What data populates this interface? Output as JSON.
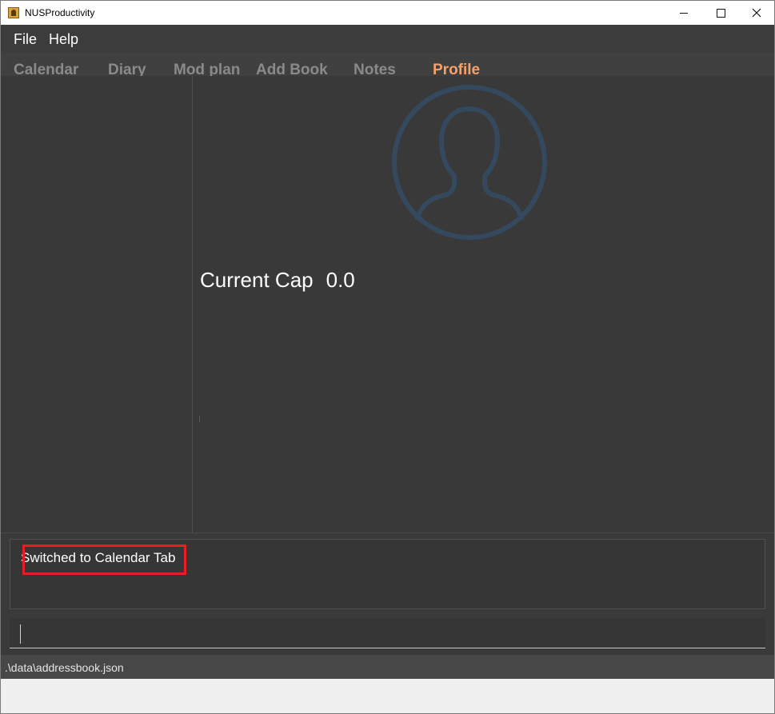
{
  "window": {
    "title": "NUSProductivity"
  },
  "menu": {
    "file": "File",
    "help": "Help"
  },
  "tabs": [
    {
      "label": "Calendar",
      "active": false
    },
    {
      "label": "Diary",
      "active": false
    },
    {
      "label": "Mod plan",
      "active": false
    },
    {
      "label": "Add Book",
      "active": false
    },
    {
      "label": "Notes",
      "active": false
    },
    {
      "label": "Profile",
      "active": true
    }
  ],
  "profile": {
    "cap_label": "Current Cap",
    "cap_value": "0.0",
    "avatar_icon": "user-silhouette-icon"
  },
  "result": {
    "message": "Switched to Calendar Tab"
  },
  "command": {
    "value": "",
    "placeholder": ""
  },
  "status": {
    "path": ".\\data\\addressbook.json"
  },
  "colors": {
    "accent": "#f3a26b",
    "background": "#393939",
    "highlight": "#e81d25",
    "avatar": "#34495e"
  }
}
